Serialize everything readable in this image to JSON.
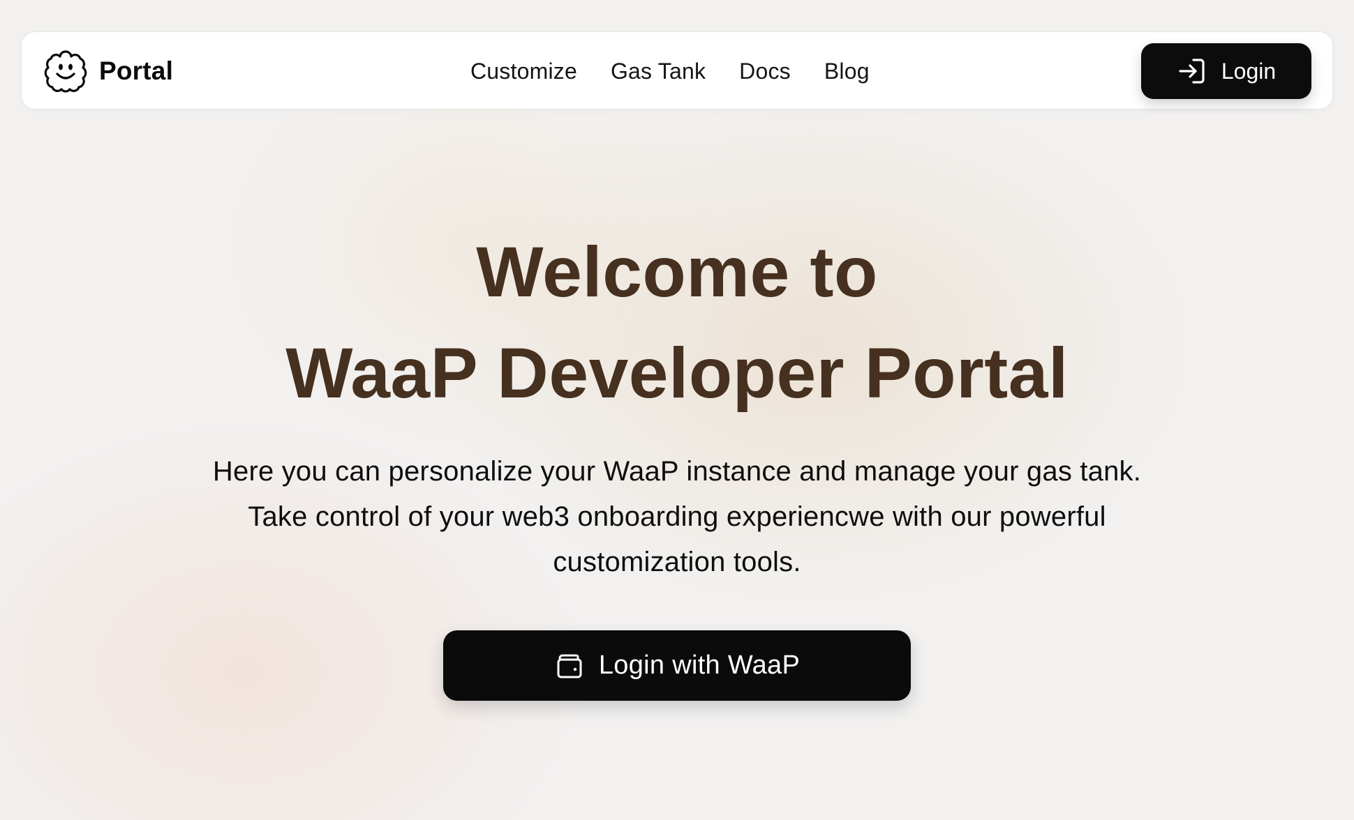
{
  "header": {
    "brand": {
      "name": "Portal",
      "logo_icon": "smiling-cloud-icon"
    },
    "nav": [
      {
        "label": "Customize"
      },
      {
        "label": "Gas Tank"
      },
      {
        "label": "Docs"
      },
      {
        "label": "Blog"
      }
    ],
    "login_button": {
      "label": "Login",
      "icon": "login-arrow-icon"
    }
  },
  "hero": {
    "title_line1": "Welcome to",
    "title_line2": "WaaP Developer Portal",
    "description": "Here you can personalize your WaaP instance and manage your gas tank. Take control of your web3 onboarding experiencwe with our powerful customization tools.",
    "cta_button": {
      "label": "Login with WaaP",
      "icon": "wallet-icon"
    }
  },
  "colors": {
    "title": "#46301f",
    "button_bg": "#0b0b0b",
    "button_text": "#ffffff",
    "navbar_bg": "#ffffff",
    "page_bg": "#f2f1f0"
  }
}
